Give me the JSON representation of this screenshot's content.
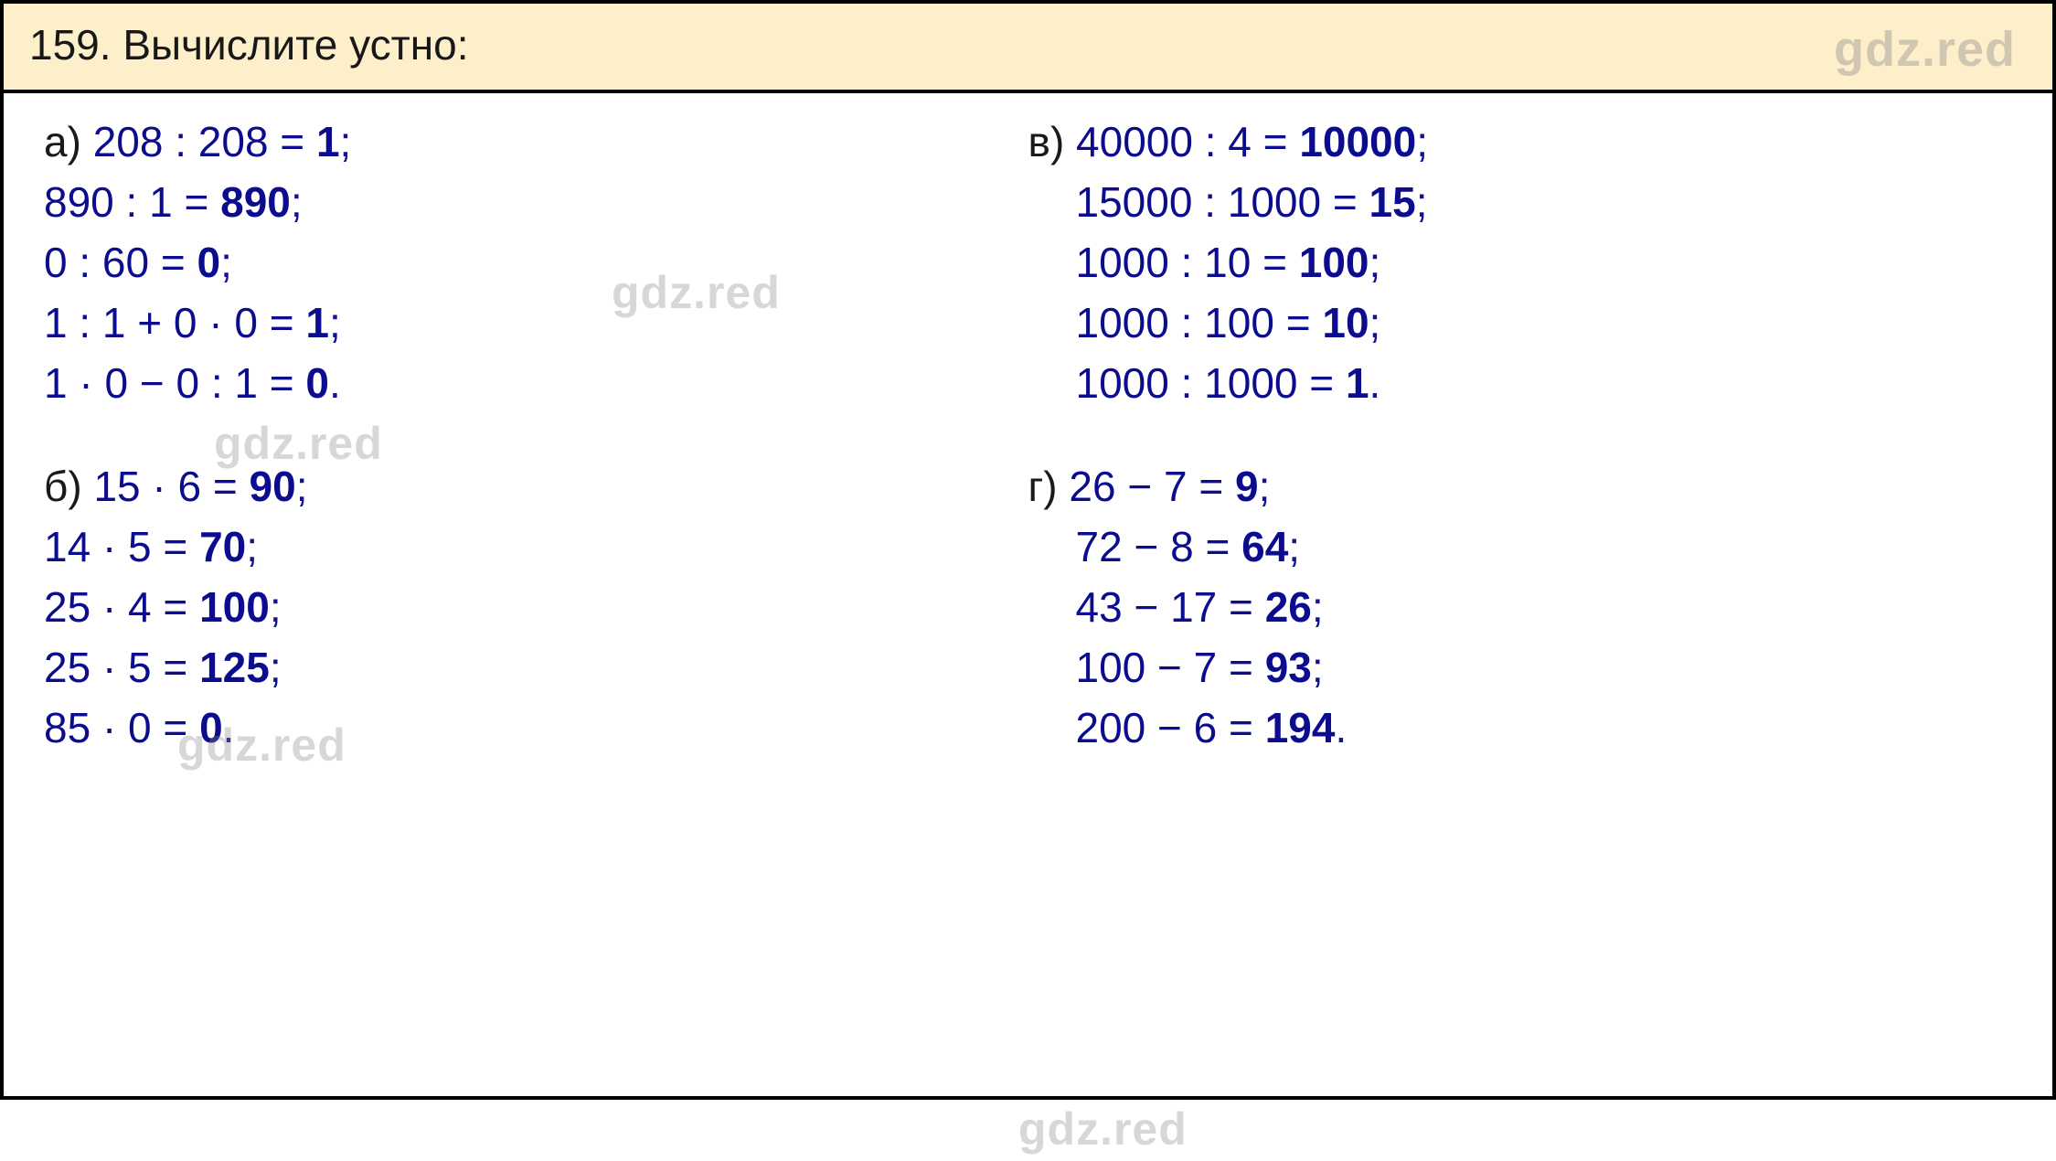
{
  "header": {
    "task_number": "159.",
    "task_title": "Вычислите устно:"
  },
  "watermark": "gdz.red",
  "groups": {
    "a": {
      "label": "а)",
      "lines": [
        {
          "expr": "208 : 208 = ",
          "answer": "1",
          "punct": ";"
        },
        {
          "expr": "890 : 1 = ",
          "answer": "890",
          "punct": ";"
        },
        {
          "expr": "0 : 60 = ",
          "answer": "0",
          "punct": ";"
        },
        {
          "expr": "1 : 1 + 0 · 0 = ",
          "answer": "1",
          "punct": ";"
        },
        {
          "expr": "1 · 0 − 0 : 1 = ",
          "answer": "0",
          "punct": "."
        }
      ]
    },
    "b": {
      "label": "б)",
      "lines": [
        {
          "expr": "15 · 6 = ",
          "answer": "90",
          "punct": ";"
        },
        {
          "expr": "14 · 5 = ",
          "answer": "70",
          "punct": ";"
        },
        {
          "expr": "25 · 4 = ",
          "answer": "100",
          "punct": ";"
        },
        {
          "expr": "25 · 5 = ",
          "answer": "125",
          "punct": ";"
        },
        {
          "expr": "85 · 0 = ",
          "answer": "0",
          "punct": "."
        }
      ]
    },
    "v": {
      "label": "в)",
      "lines": [
        {
          "expr": "40000 : 4 = ",
          "answer": "10000",
          "punct": ";"
        },
        {
          "expr": "15000 : 1000 = ",
          "answer": "15",
          "punct": ";"
        },
        {
          "expr": "1000 : 10 = ",
          "answer": "100",
          "punct": ";"
        },
        {
          "expr": "1000 : 100 = ",
          "answer": "10",
          "punct": ";"
        },
        {
          "expr": "1000 : 1000 = ",
          "answer": "1",
          "punct": "."
        }
      ]
    },
    "g": {
      "label": "г)",
      "lines": [
        {
          "expr": "26 − 7 = ",
          "answer": "9",
          "punct": ";"
        },
        {
          "expr": "72 − 8 = ",
          "answer": "64",
          "punct": ";"
        },
        {
          "expr": "43 − 17 = ",
          "answer": "26",
          "punct": ";"
        },
        {
          "expr": "100 − 7 = ",
          "answer": "93",
          "punct": ";"
        },
        {
          "expr": "200 − 6 = ",
          "answer": "194",
          "punct": "."
        }
      ]
    }
  }
}
